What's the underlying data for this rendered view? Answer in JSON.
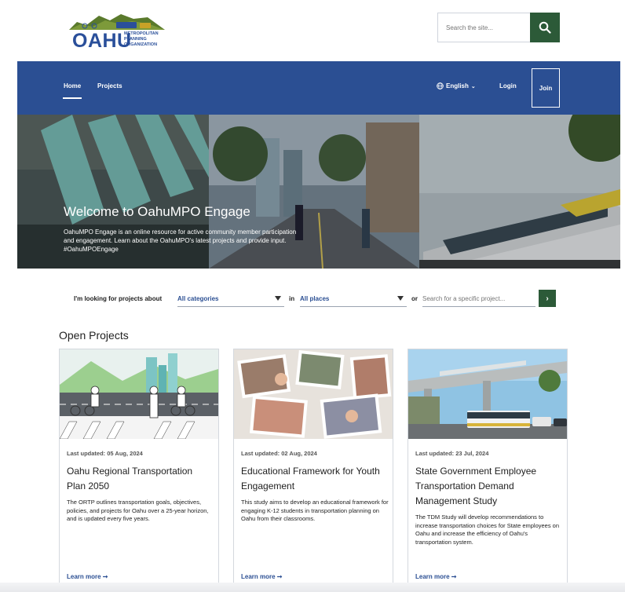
{
  "header": {
    "logo_text": "OAHU",
    "logo_subtext": "METROPOLITAN PLANNING ORGANIZATION",
    "search_placeholder": "Search the site..."
  },
  "nav": {
    "items": [
      {
        "label": "Home",
        "active": true
      },
      {
        "label": "Projects",
        "active": false
      }
    ],
    "language": "English",
    "login": "Login",
    "join": "Join"
  },
  "hero": {
    "title": "Welcome to OahuMPO Engage",
    "description": "OahuMPO Engage is an online resource for active community member participation and engagement. Learn about the OahuMPO's latest projects and provide input. #OahuMPOEngage"
  },
  "filter": {
    "looking_label": "I'm looking for projects about",
    "category_value": "All categories",
    "in_label": "in",
    "place_value": "All places",
    "or_label": "or",
    "specific_placeholder": "Search for a specific project..."
  },
  "section_title": "Open Projects",
  "cards": [
    {
      "updated": "Last updated: 05 Aug, 2024",
      "title": "Oahu Regional Transportation Plan 2050",
      "description": "The ORTP outlines transportation goals, objectives, policies, and projects for Oahu over a 25-year horizon, and is updated every five years.",
      "learn_more": "Learn more ➞"
    },
    {
      "updated": "Last updated: 02 Aug, 2024",
      "title": "Educational Framework for Youth Engagement",
      "description": "This study aims to develop an educational framework for engaging K-12 students in transportation planning on Oahu from their classrooms.",
      "learn_more": "Learn more ➞"
    },
    {
      "updated": "Last updated: 23 Jul, 2024",
      "title": "State Government Employee Transportation Demand Management Study",
      "description": "The TDM Study will develop recommendations to increase transportation choices for State employees on Oahu and increase the efficiency of Oahu's transportation system.",
      "learn_more": "Learn more ➞"
    }
  ],
  "colors": {
    "nav_blue": "#2b4f93",
    "button_green": "#2c5a38",
    "link_blue": "#2b4f93"
  }
}
